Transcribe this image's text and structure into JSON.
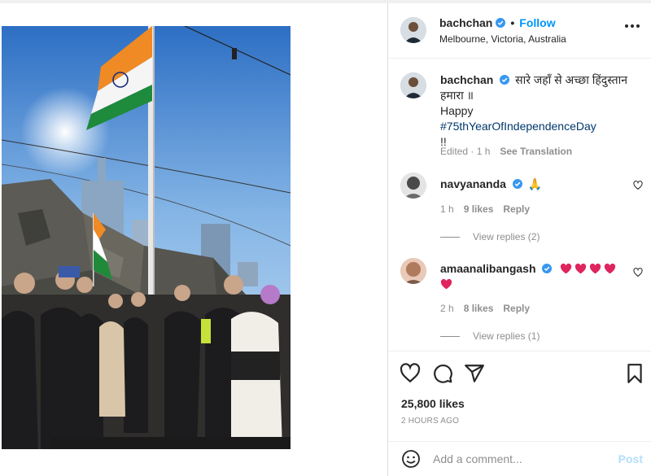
{
  "post": {
    "username": "bachchan",
    "follow_label": "Follow",
    "separator": "•",
    "location": "Melbourne, Victoria, Australia"
  },
  "caption": {
    "username": "bachchan",
    "text": "सारे जहाँ से अच्छा हिंदुस्तान हमारा ॥",
    "line2_prefix": "Happy ",
    "hashtag": "#75thYearOfIndependenceDay",
    "line3": "!!",
    "edited": "Edited · 1 h",
    "see_translation": "See Translation"
  },
  "comments": [
    {
      "username": "navyananda",
      "emoji": "🙏",
      "time": "1 h",
      "likes": "9 likes",
      "reply": "Reply",
      "view_replies": "View replies (2)"
    },
    {
      "username": "amaanalibangash",
      "time": "2 h",
      "likes": "8 likes",
      "reply": "Reply",
      "view_replies": "View replies (1)",
      "heart_color": "#e0245e"
    }
  ],
  "actions": {
    "likes": "25,800 likes",
    "posted": "2 HOURS AGO"
  },
  "add_comment": {
    "placeholder": "Add a comment...",
    "post_label": "Post"
  },
  "colors": {
    "accent": "#0095f6",
    "verified": "#3897f0",
    "muted": "#8e8e8e"
  },
  "icons": [
    "verified-icon",
    "more-options-icon",
    "like-heart-icon",
    "comment-icon",
    "share-icon",
    "save-bookmark-icon",
    "emoji-smile-icon"
  ]
}
